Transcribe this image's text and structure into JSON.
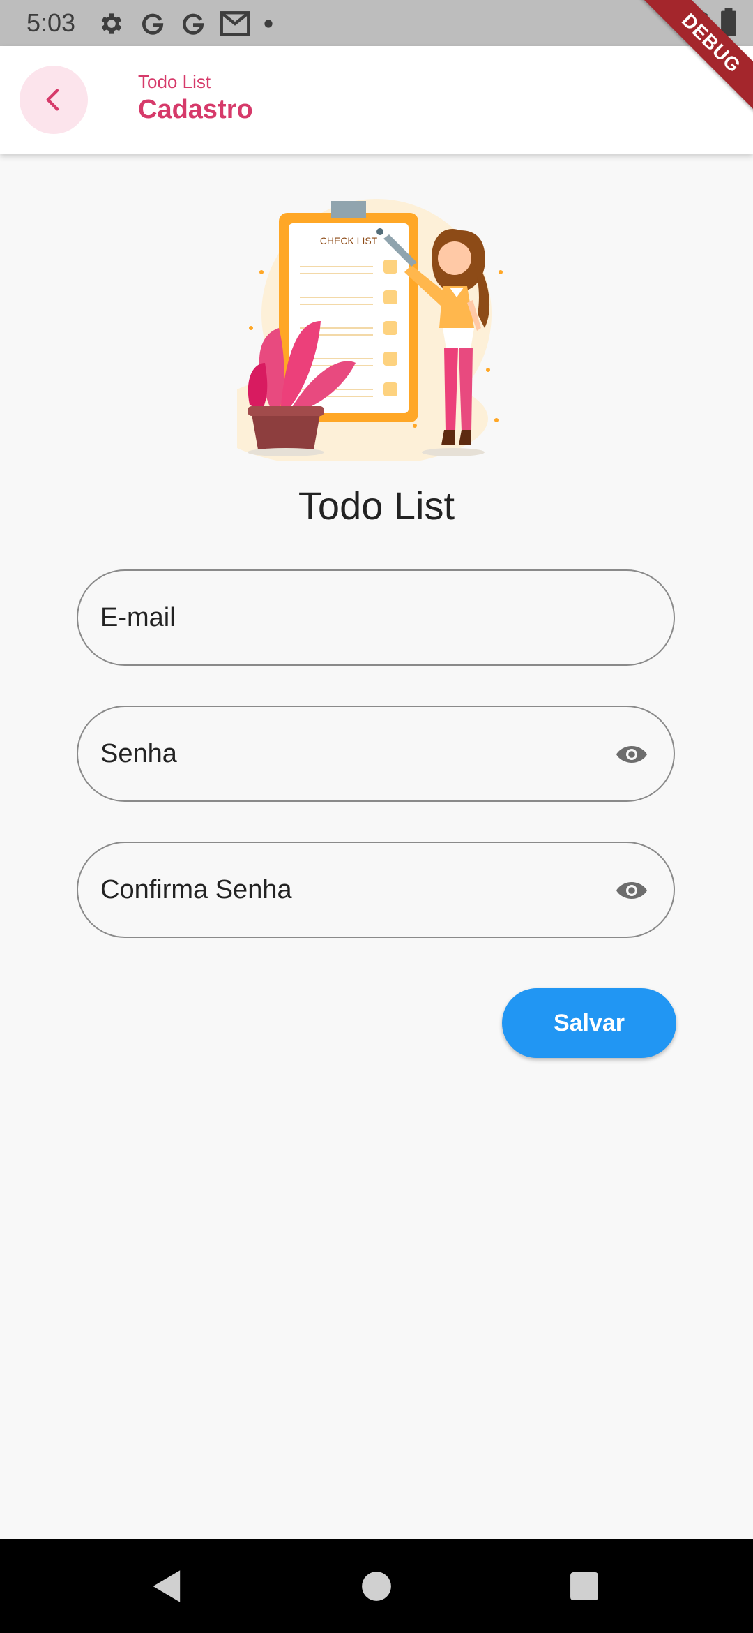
{
  "status_bar": {
    "time": "5:03",
    "icons": [
      "gear-icon",
      "google-g-icon",
      "google-g-icon",
      "gmail-icon",
      "dot-icon"
    ],
    "right_icons": [
      "wifi-icon",
      "battery-icon"
    ]
  },
  "debug_banner": "DEBUG",
  "app_bar": {
    "subtitle": "Todo List",
    "title": "Cadastro",
    "accent_color": "#d63a6a"
  },
  "illustration": {
    "caption": "CHECK LIST"
  },
  "page": {
    "title": "Todo List"
  },
  "form": {
    "email_label": "E-mail",
    "password_label": "Senha",
    "confirm_label": "Confirma Senha",
    "save_label": "Salvar",
    "save_color": "#2196f3"
  },
  "nav_bar": {
    "buttons": [
      "back-triangle-icon",
      "home-circle-icon",
      "recents-square-icon"
    ]
  }
}
